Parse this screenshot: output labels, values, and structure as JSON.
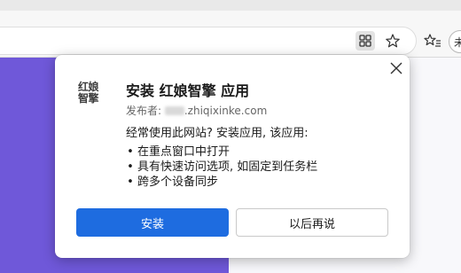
{
  "browser": {
    "toolbar": {
      "apps_icon": "apps-grid-icon",
      "star_icon": "star-icon",
      "favorites_icon": "favorites-icon",
      "profile_initial": "未"
    }
  },
  "popup": {
    "logo_text_line1": "红娘",
    "logo_text_line2": "智擎",
    "title": "安装 红娘智擎 应用",
    "publisher_label": "发布者: ",
    "publisher_domain": ".zhiqixinke.com",
    "question": "经常使用此网站? 安装应用, 该应用:",
    "features": [
      "在重点窗口中打开",
      "具有快速访问选项, 如固定到任务栏",
      "跨多个设备同步"
    ],
    "install_label": "安装",
    "later_label": "以后再说",
    "close_icon": "close-icon"
  },
  "colors": {
    "hero": "#6f58d9",
    "primary_button": "#1e6ce0"
  }
}
